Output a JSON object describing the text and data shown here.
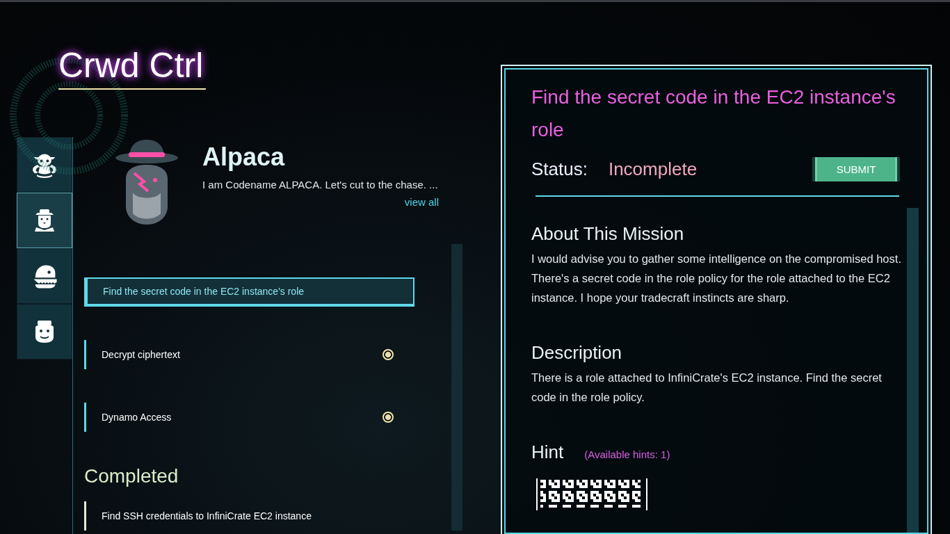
{
  "app": {
    "title": "Crwd Ctrl"
  },
  "characters": [
    {
      "selected": false
    },
    {
      "selected": true
    },
    {
      "selected": false
    },
    {
      "selected": false
    }
  ],
  "profile": {
    "name": "Alpaca",
    "bio": "I am Codename ALPACA. Let's cut to the chase. ...",
    "link": "view all"
  },
  "missions": [
    {
      "title": "Find the secret code in the EC2 instance's role",
      "selected": true
    },
    {
      "title": "Decrypt ciphertext",
      "selected": false
    },
    {
      "title": "Dynamo Access",
      "selected": false
    }
  ],
  "completed": {
    "heading": "Completed",
    "items": [
      {
        "title": "Find SSH credentials to InfiniCrate EC2 instance"
      }
    ]
  },
  "detail": {
    "title": "Find the secret code in the EC2 instance's role",
    "status_label": "Status:",
    "status": "Incomplete",
    "submit": "SUBMIT",
    "sections": [
      {
        "heading": "About This Mission",
        "text": "I would advise you to gather some intelligence on the compromised host. There's a secret code in the role policy for the role attached to the EC2 instance. I hope your tradecraft instincts are sharp."
      },
      {
        "heading": "Description",
        "text": "There is a role attached to InfiniCrate's EC2 instance. Find the secret code in the role policy."
      }
    ],
    "hint": {
      "heading": "Hint",
      "available": "(Available hints: 1)"
    }
  }
}
